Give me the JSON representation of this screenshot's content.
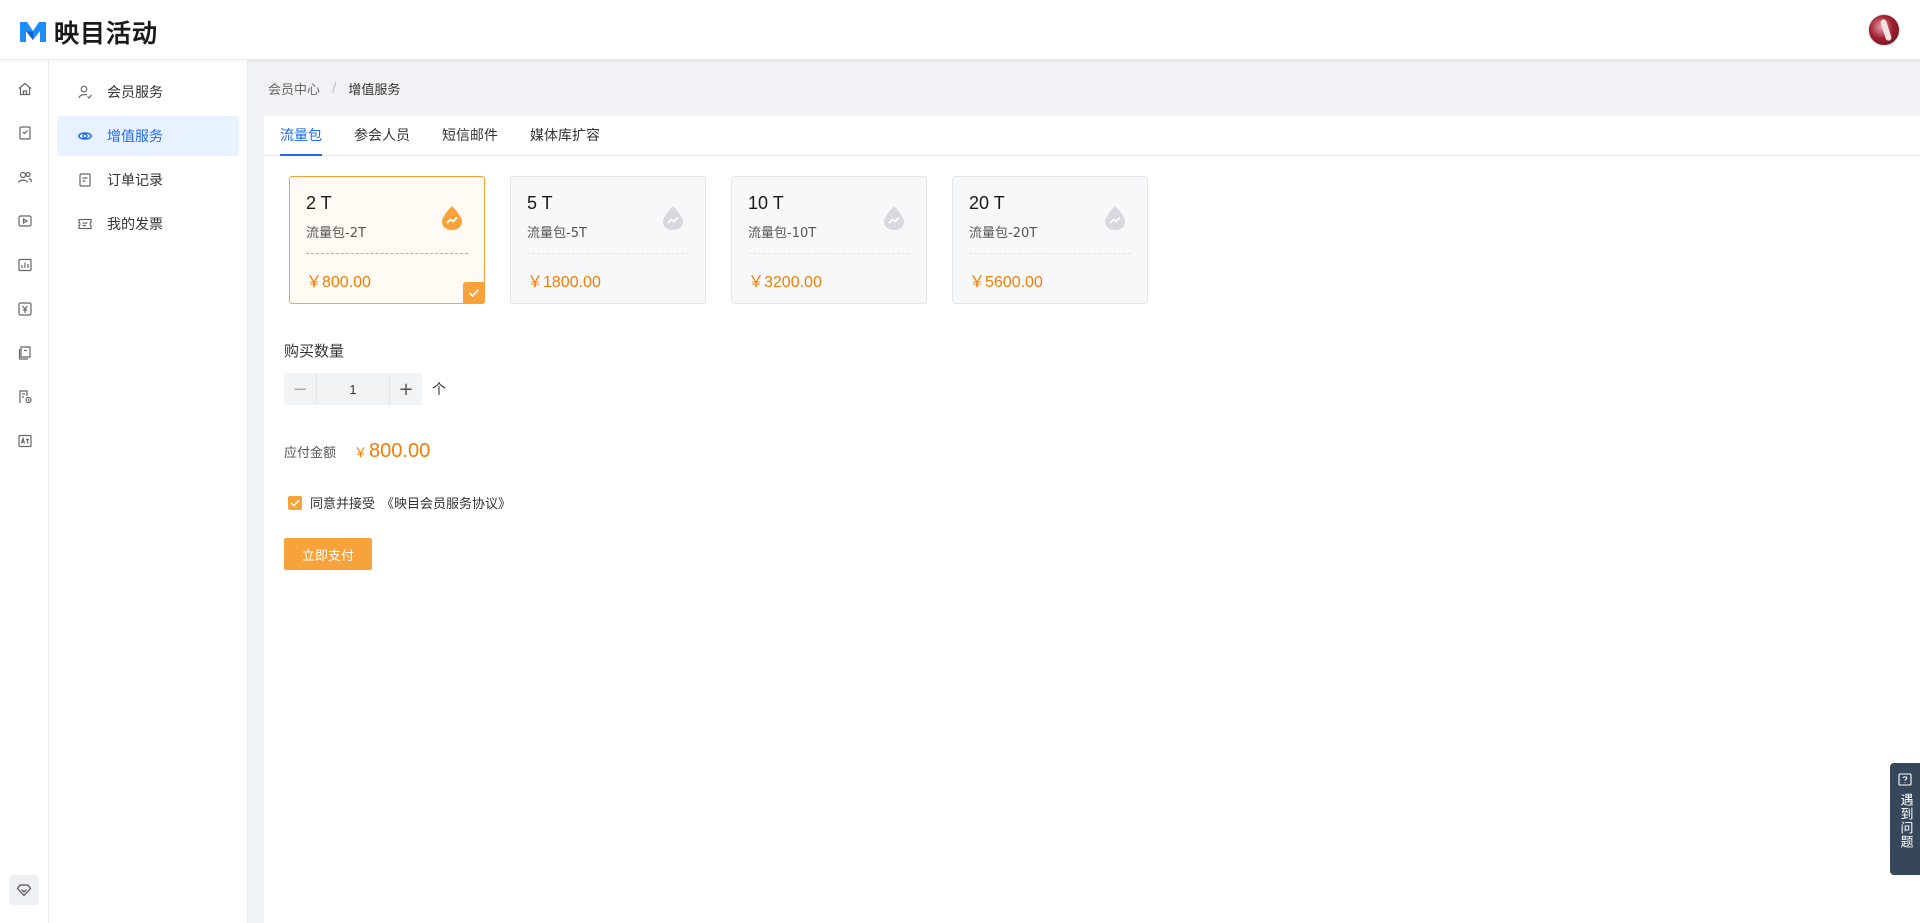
{
  "app": {
    "name": "映目活动"
  },
  "sidebar": {
    "items": [
      {
        "label": "会员服务",
        "icon": "user-check-icon"
      },
      {
        "label": "增值服务",
        "icon": "eye-icon"
      },
      {
        "label": "订单记录",
        "icon": "document-icon"
      },
      {
        "label": "我的发票",
        "icon": "ticket-icon"
      }
    ],
    "active_index": 1
  },
  "rail": {
    "icons": [
      "home-icon",
      "bookmark-icon",
      "users-icon",
      "video-icon",
      "chart-icon",
      "yen-icon",
      "certificate-icon",
      "building-icon",
      "translate-icon"
    ],
    "bottom_icon": "diamond-icon"
  },
  "breadcrumb": {
    "parent": "会员中心",
    "separator": "/",
    "current": "增值服务"
  },
  "tabs": [
    {
      "label": "流量包",
      "active": true
    },
    {
      "label": "参会人员",
      "active": false
    },
    {
      "label": "短信邮件",
      "active": false
    },
    {
      "label": "媒体库扩容",
      "active": false
    }
  ],
  "packages": [
    {
      "title": "2 T",
      "name": "流量包-2T",
      "price": "￥800.00",
      "selected": true
    },
    {
      "title": "5 T",
      "name": "流量包-5T",
      "price": "￥1800.00",
      "selected": false
    },
    {
      "title": "10 T",
      "name": "流量包-10T",
      "price": "￥3200.00",
      "selected": false
    },
    {
      "title": "20 T",
      "name": "流量包-20T",
      "price": "￥5600.00",
      "selected": false
    }
  ],
  "quantity": {
    "label": "购买数量",
    "value": "1",
    "unit": "个",
    "minus": "−",
    "plus": "+"
  },
  "amount": {
    "label": "应付金额",
    "currency": "￥",
    "value": "800.00"
  },
  "agreement": {
    "text": "同意并接受",
    "link": "《映目会员服务协议》",
    "checked": true
  },
  "pay_button": {
    "label": "立即支付"
  },
  "help": {
    "label": "遇到问题"
  },
  "colors": {
    "primary": "#1d6cf2",
    "accent": "#f7a23b",
    "price": "#f57c00"
  }
}
